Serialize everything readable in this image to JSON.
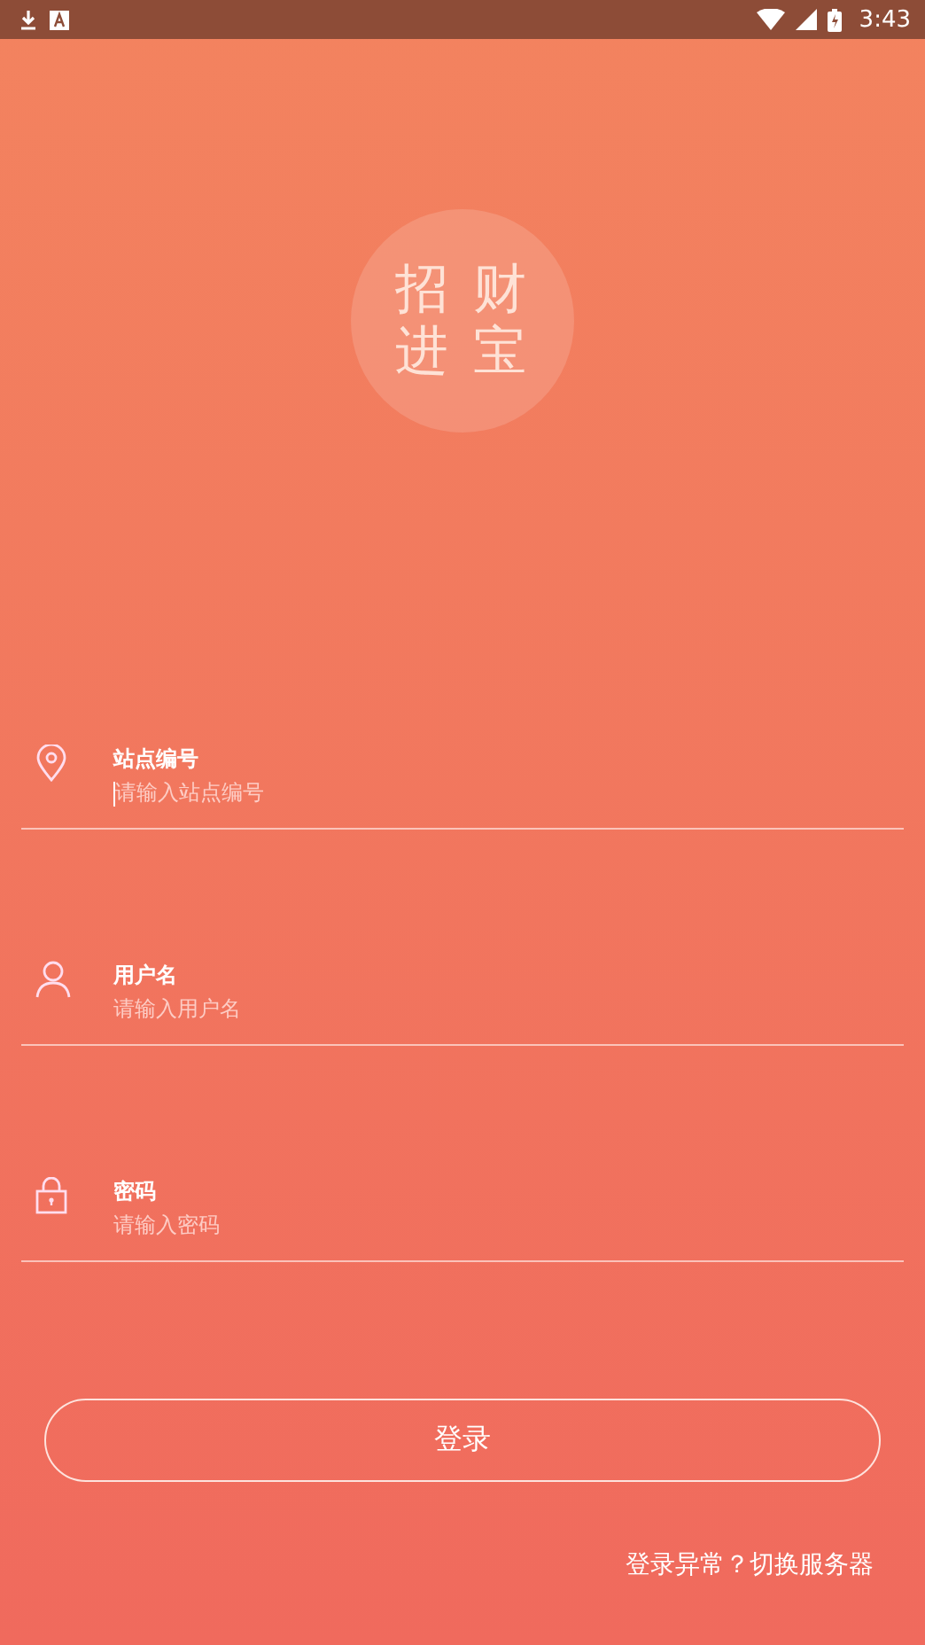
{
  "status_bar": {
    "time": "3:43"
  },
  "logo": {
    "lines": [
      "招 财",
      "进 宝"
    ]
  },
  "fields": [
    {
      "kind": "location",
      "label": "站点编号",
      "placeholder": "请输入站点编号",
      "focused": true
    },
    {
      "kind": "user",
      "label": "用户名",
      "placeholder": "请输入用户名",
      "focused": false
    },
    {
      "kind": "lock",
      "label": "密码",
      "placeholder": "请输入密码",
      "focused": false
    }
  ],
  "login_button": "登录",
  "server_link": "登录异常？切换服务器"
}
